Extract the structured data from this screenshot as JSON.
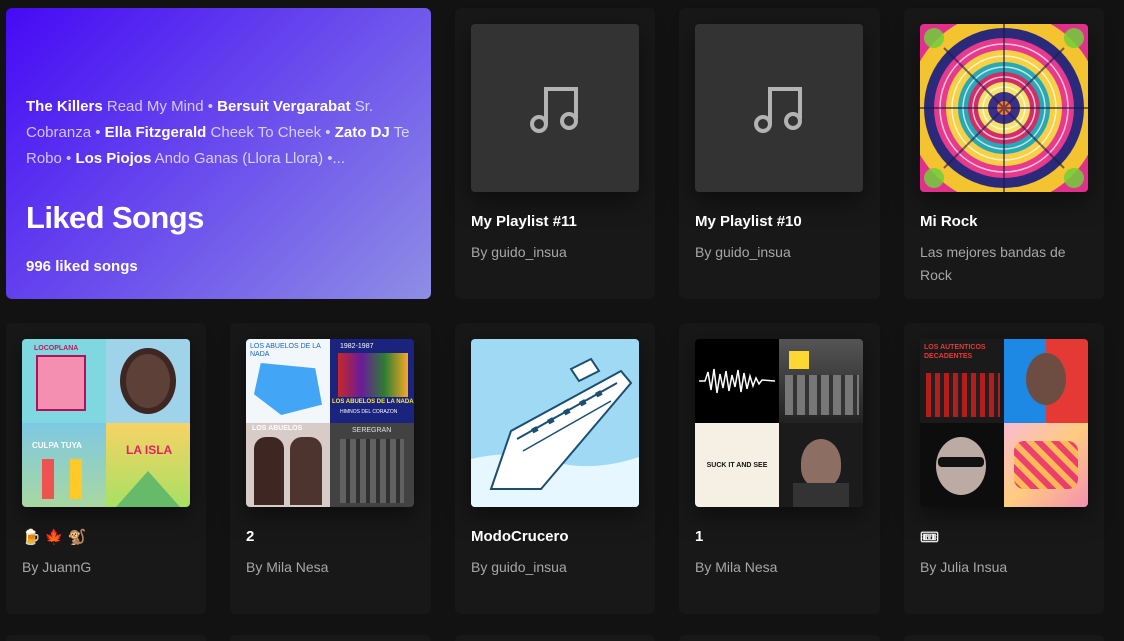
{
  "liked": {
    "preview": [
      {
        "artist": "The Killers",
        "song": "Read My Mind"
      },
      {
        "artist": "Bersuit Vergarabat",
        "song": "Sr. Cobranza"
      },
      {
        "artist": "Ella Fitzgerald",
        "song": "Cheek To Cheek"
      },
      {
        "artist": "Zato DJ",
        "song": "Te Robo"
      },
      {
        "artist": "Los Piojos",
        "song": "Ando Ganas (Llora Llora)"
      }
    ],
    "separator": " • ",
    "ellipsis": " •...",
    "title": "Liked Songs",
    "count": "996 liked songs"
  },
  "playlists": [
    {
      "title": "My Playlist #11",
      "subtitle": "By guido_insua",
      "cover": "music-note-icon"
    },
    {
      "title": "My Playlist #10",
      "subtitle": "By guido_insua",
      "cover": "music-note-icon"
    },
    {
      "title": "Mi Rock",
      "subtitle": "Las mejores bandas de Rock",
      "cover": "mandala-art"
    },
    {
      "title": "🍺 🍁 🐒",
      "subtitle": "By JuannG",
      "cover": "mosaic"
    },
    {
      "title": "2",
      "subtitle": "By Mila Nesa",
      "cover": "mosaic"
    },
    {
      "title": "ModoCrucero",
      "subtitle": "By guido_insua",
      "cover": "cruise-ship-art"
    },
    {
      "title": "1",
      "subtitle": "By Mila Nesa",
      "cover": "mosaic"
    },
    {
      "title": "🎟",
      "subtitle": "By Julia Insua",
      "cover": "mosaic"
    }
  ],
  "mosaic_texts": {
    "p4_tl": "LOCOPLANA",
    "p4_bl": "CULPA TUYA",
    "p4_br": "LA ISLA",
    "p5_tl": "LOS ABUELOS DE LA NADA",
    "p5_tr_year": "1982-1987",
    "p5_tr": "LOS ABUELOS DE LA NADA",
    "p5_tr_sub": "HIMNOS DEL CORAZON",
    "p5_bl": "LOS ABUELOS",
    "p5_br": "SEREGRAN",
    "p7_bl": "SUCK IT AND SEE",
    "p8_tl": "LOS AUTENTICOS DECADENTES"
  }
}
